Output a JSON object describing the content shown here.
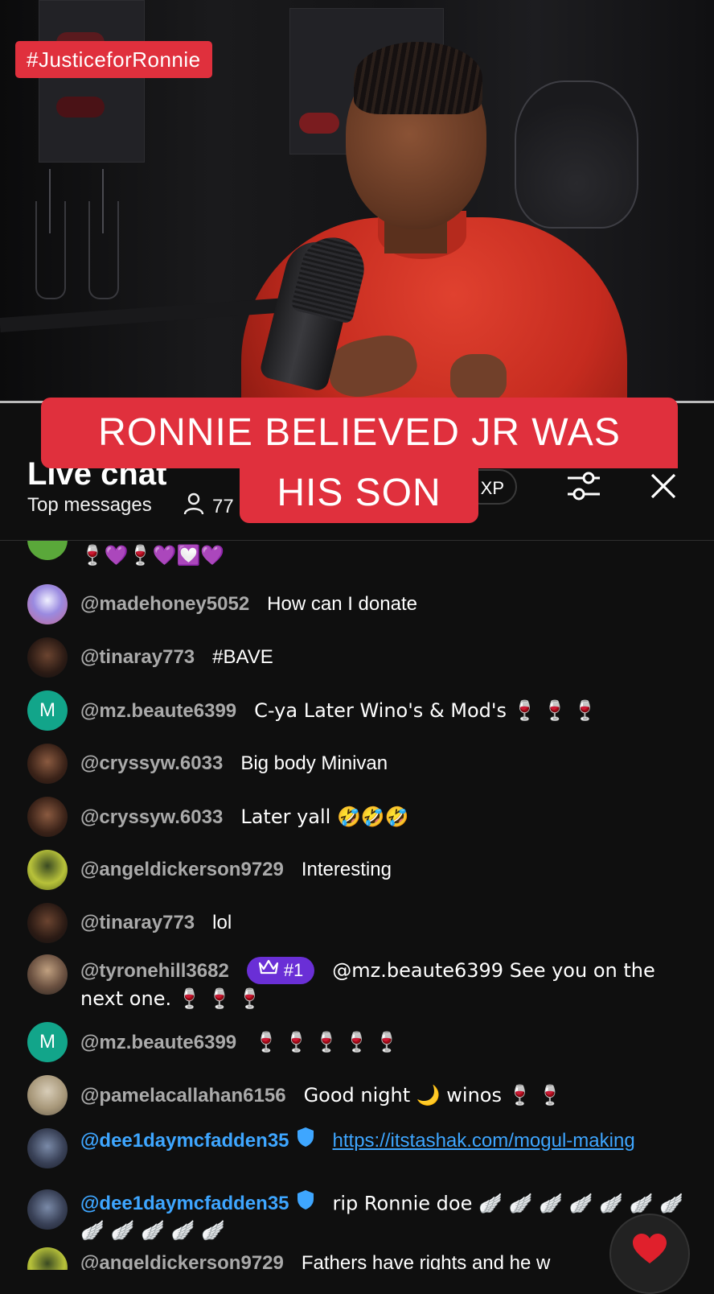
{
  "video": {
    "hashtag": "#JusticeforRonnie"
  },
  "caption": {
    "line1": "RONNIE BELIEVED JR WAS",
    "line2": "HIS SON"
  },
  "chat_header": {
    "title": "Live chat",
    "mode": "Top messages",
    "viewer_count": "77",
    "xp_label": "XP",
    "icons": [
      "person-icon",
      "filter-sliders-icon",
      "close-icon"
    ]
  },
  "colors": {
    "accent_red": "#e0303d",
    "author_grey": "#aaaaaa",
    "verified_blue": "#3ea6ff",
    "badge_purple": "#6a2fd6"
  },
  "messages": [
    {
      "author": "",
      "text": "🍷💜🍷💜💟💜",
      "avatar": "green",
      "partial": true
    },
    {
      "author": "@madehoney5052",
      "text": "How can I donate",
      "avatar": "photo-flower"
    },
    {
      "author": "@tinaray773",
      "text": "#BAVE",
      "avatar": "photo-woman"
    },
    {
      "author": "@mz.beaute6399",
      "text": "C-ya Later Wino's & Mod's 🍷 🍷 🍷",
      "avatar": "M"
    },
    {
      "author": "@cryssyw.6033",
      "text": "Big body Minivan",
      "avatar": "photo-woman"
    },
    {
      "author": "@cryssyw.6033",
      "text": "Later yall 🤣🤣🤣",
      "avatar": "photo-woman"
    },
    {
      "author": "@angeldickerson9729",
      "text": "Interesting",
      "avatar": "photo-green"
    },
    {
      "author": "@tinaray773",
      "text": "lol",
      "avatar": "photo-woman"
    },
    {
      "author": "@tyronehill3682",
      "badge": "#1",
      "text": "@mz.beaute6399 See you on the next one. 🍷 🍷 🍷",
      "avatar": "photo-man"
    },
    {
      "author": "@mz.beaute6399",
      "text": "🍷 🍷 🍷 🍷 🍷",
      "avatar": "M"
    },
    {
      "author": "@pamelacallahan6156",
      "text": "Good night 🌙 winos 🍷 🍷",
      "avatar": "photo-beige"
    },
    {
      "author": "@dee1daymcfadden35",
      "verified": true,
      "link": "https://itstashak.com/mogul-making",
      "avatar": "photo-couple"
    },
    {
      "author": "@dee1daymcfadden35",
      "verified": true,
      "text": "rip Ronnie doe 🪽 🪽 🪽 🪽 🪽 🪽 🪽 🪽 🪽 🪽 🪽 🪽",
      "avatar": "photo-couple"
    },
    {
      "author": "@angeldickerson9729",
      "text": "Fathers have rights and he w",
      "avatar": "photo-green",
      "partial": true
    }
  ],
  "reaction_button": {
    "icon": "heart-icon"
  }
}
